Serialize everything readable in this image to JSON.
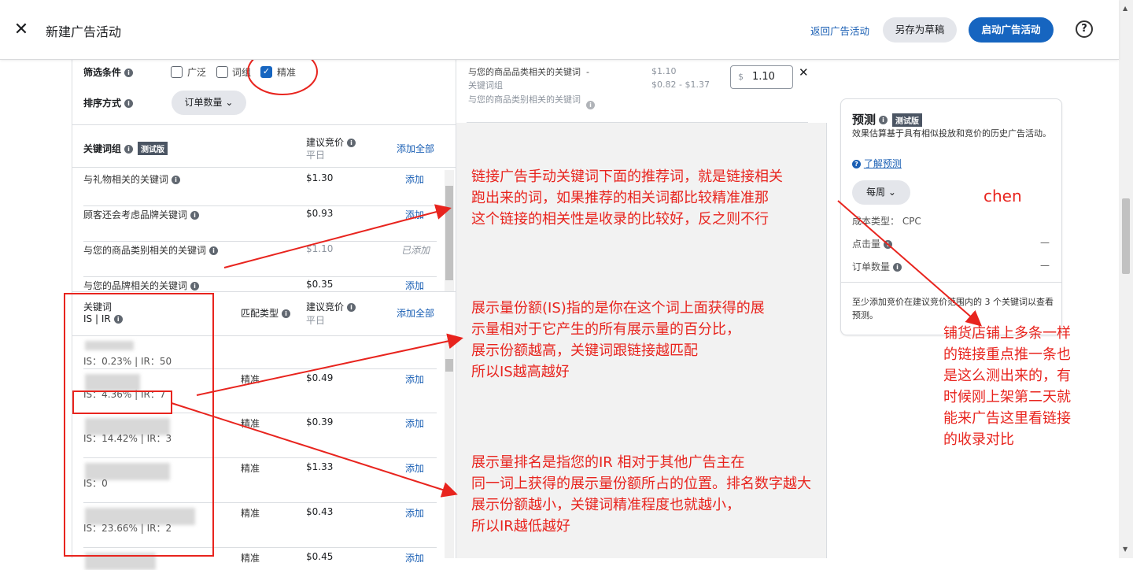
{
  "topbar": {
    "title": "新建广告活动",
    "back_link": "返回广告活动",
    "save_draft": "另存为草稿",
    "launch": "启动广告活动",
    "help": "?"
  },
  "filters": {
    "label": "筛选条件",
    "options": [
      "广泛",
      "词组",
      "精准"
    ],
    "checked": [
      false,
      false,
      true
    ],
    "sort_label": "排序方式",
    "sort_value": "订单数量"
  },
  "keyword_groups": {
    "header": "关键词组",
    "beta": "测试版",
    "bid_header": "建议竞价",
    "bid_sub": "平日",
    "add_all": "添加全部",
    "rows": [
      {
        "name": "与礼物相关的关键词",
        "bid": "$1.30",
        "action": "添加"
      },
      {
        "name": "顾客还会考虑品牌关键词",
        "bid": "$0.93",
        "action": "添加"
      },
      {
        "name": "与您的商品类别相关的关键词",
        "bid": "$1.10",
        "action": "已添加"
      },
      {
        "name": "与您的品牌相关的关键词",
        "bid": "$0.35",
        "action": "添加"
      }
    ]
  },
  "keywords": {
    "header": "关键词",
    "sub": "IS | IR",
    "match_header": "匹配类型",
    "bid_header": "建议竞价",
    "bid_sub": "平日",
    "add_all": "添加全部",
    "rows": [
      {
        "match": "",
        "bid": "",
        "action": "",
        "metrics": "IS：0.23% | IR：50"
      },
      {
        "match": "精准",
        "bid": "$0.49",
        "action": "添加",
        "metrics": "IS：4.36% | IR：7"
      },
      {
        "match": "精准",
        "bid": "$0.39",
        "action": "添加",
        "metrics": "IS：14.42% | IR：3"
      },
      {
        "match": "精准",
        "bid": "$1.33",
        "action": "添加",
        "metrics": "IS：0"
      },
      {
        "match": "精准",
        "bid": "$0.43",
        "action": "添加",
        "metrics": "IS：23.66% | IR：2"
      },
      {
        "match": "精准",
        "bid": "$0.45",
        "action": "添加",
        "metrics": ""
      }
    ]
  },
  "added": {
    "name": "与您的商品品类相关的关键词",
    "dash": "-",
    "type": "关键词组",
    "desc": "与您的商品类别相关的关键词",
    "bid": "$1.10",
    "range": "$0.82 - $1.37",
    "currency": "$",
    "input_value": "1.10",
    "remove": "✕"
  },
  "forecast": {
    "title": "预测",
    "beta": "测试版",
    "desc": "效果估算基于具有相似投放和竞价的历史广告活动。",
    "learn": "了解预测",
    "period": "每周",
    "cost_type": "成本类型： CPC",
    "clicks": "点击量",
    "orders": "订单数量",
    "clicks_value": "—",
    "orders_value": "—",
    "footer": "至少添加竞价在建议竞价范围内的 3 个关键词以查看预测。"
  },
  "annotations": {
    "note1": [
      "链接广告手动关键词下面的推荐词，就是链接相关",
      "跑出来的词，如果推荐的相关词都比较精准准那",
      "这个链接的相关性是收录的比较好，反之则不行"
    ],
    "note2": [
      "展示量份额(IS)指的是你在这个词上面获得的展",
      "示量相对于它产生的所有展示量的百分比，",
      "展示份额越高，关键词跟链接越匹配",
      "所以IS越高越好"
    ],
    "note3": [
      "展示量排名是指您的IR 相对于其他广告主在",
      "同一词上获得的展示量份额所占的位置。排名数字越大",
      "展示份额越小，关键词精准程度也就越小，",
      "所以IR越低越好"
    ],
    "note4": [
      "铺货店铺上多条一样",
      "的链接重点推一条也",
      "是这么测出来的，有",
      "时候刚上架第二天就",
      "能来广告这里看链接",
      "的收录对比"
    ],
    "signature": "chen",
    "color": "#e8241e"
  }
}
